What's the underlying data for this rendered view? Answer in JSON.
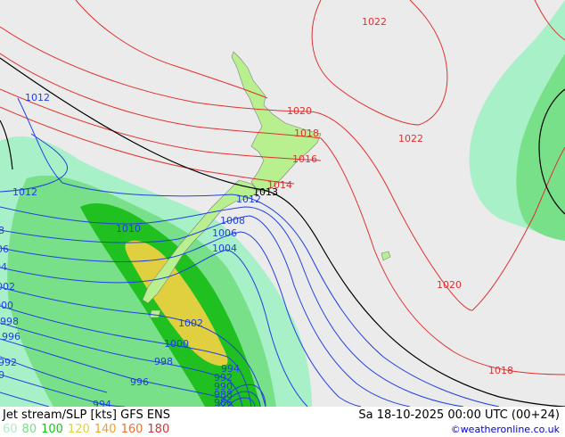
{
  "footer": {
    "title": "Jet stream/SLP [kts] GFS ENS",
    "datetime": "Sa 18-10-2025 00:00 UTC (00+24)",
    "website": "©weatheronline.co.uk",
    "legend": [
      {
        "label": "60",
        "color": "#a8f0c8"
      },
      {
        "label": "80",
        "color": "#78e088"
      },
      {
        "label": "100",
        "color": "#20c020"
      },
      {
        "label": "120",
        "color": "#e0d040"
      },
      {
        "label": "140",
        "color": "#f0a030"
      },
      {
        "label": "160",
        "color": "#f07030"
      },
      {
        "label": "180",
        "color": "#e03030"
      }
    ]
  },
  "map": {
    "colors": {
      "background": "#ebebeb",
      "land": "#b8f090",
      "high_pressure": "#e03030",
      "low_pressure": "#2040e0",
      "reference": "#000000"
    },
    "isobar_labels_red": [
      "1022",
      "1022",
      "1020",
      "1018",
      "1016",
      "1014",
      "1020",
      "1018"
    ],
    "isobar_labels_black": [
      "1013"
    ],
    "isobar_labels_blue": [
      "1012",
      "1012",
      "1012",
      "1010",
      "1008",
      "1006",
      "1004",
      "1002",
      "1000",
      "998",
      "996",
      "994",
      "994",
      "992",
      "990",
      "988",
      "986",
      "8",
      "06",
      "04",
      "002",
      "000",
      "998",
      "996",
      "992",
      "0"
    ]
  }
}
